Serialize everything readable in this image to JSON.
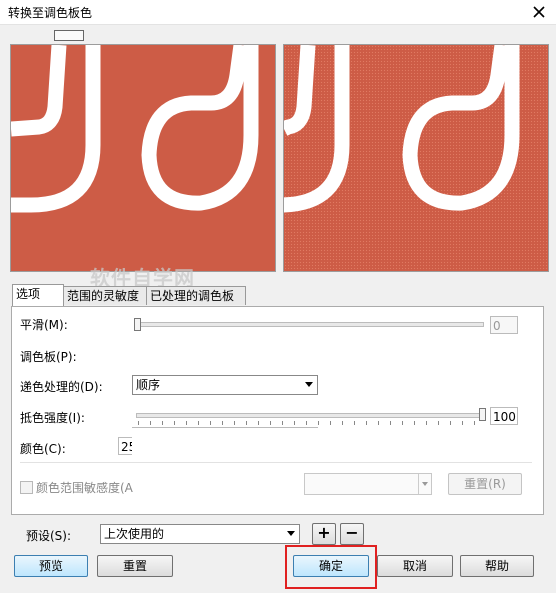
{
  "window": {
    "title": "转换至调色板色"
  },
  "watermark": "软件自学网",
  "tabs": [
    {
      "label": "选项"
    },
    {
      "label": "范围的灵敏度"
    },
    {
      "label": "已处理的调色板"
    }
  ],
  "options": {
    "smooth_label": "平滑(M):",
    "smooth_value": "0",
    "palette_label": "调色板(P):",
    "dither_label": "递色处理的(D):",
    "dither_selected": "顺序",
    "dither_strength_label": "抵色强度(I):",
    "dither_strength_value": "100",
    "color_label": "颜色(C):",
    "color_value": "25",
    "range_sensitivity_label": "颜色范围敏感度(A",
    "reset_label": "重置(R)"
  },
  "presets": {
    "label": "预设(S):",
    "selected": "上次使用的",
    "add_symbol": "+",
    "remove_symbol": "−"
  },
  "buttons": {
    "preview": "预览",
    "reset": "重置",
    "ok": "确定",
    "cancel": "取消",
    "help": "帮助"
  },
  "colors": {
    "preview_bg": "#cd5c46",
    "highlight": "#e02020"
  },
  "icons": {
    "close": "close-icon",
    "dock": "dock-toggle-icon"
  }
}
